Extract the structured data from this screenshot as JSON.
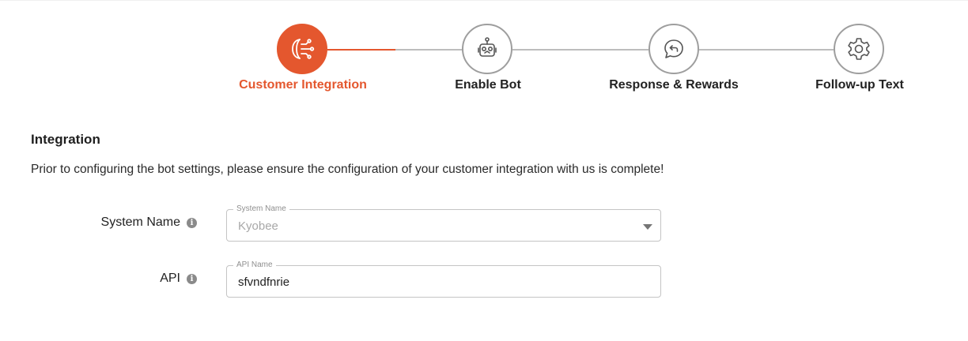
{
  "stepper": {
    "steps": [
      {
        "label": "Customer Integration",
        "icon": "integration-icon",
        "active": true
      },
      {
        "label": "Enable Bot",
        "icon": "robot-icon",
        "active": false
      },
      {
        "label": "Response & Rewards",
        "icon": "reply-bubble-icon",
        "active": false
      },
      {
        "label": "Follow-up Text",
        "icon": "gear-icon",
        "active": false
      }
    ]
  },
  "integration": {
    "title": "Integration",
    "description": "Prior to configuring the bot settings, please ensure the configuration of your customer integration with us is complete!"
  },
  "form": {
    "system_name": {
      "label": "System Name",
      "legend": "System Name",
      "value": "Kyobee"
    },
    "api": {
      "label": "API",
      "legend": "API Name",
      "value": "sfvndfnrie"
    }
  },
  "colors": {
    "accent": "#e4572e",
    "inactive_border": "#9e9e9e",
    "connector": "#bdbdbd"
  }
}
